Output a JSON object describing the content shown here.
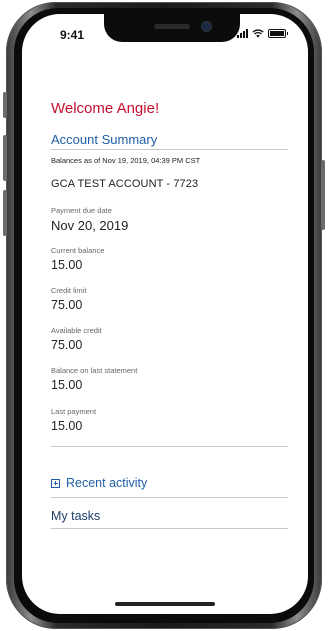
{
  "status_bar": {
    "time": "9:41",
    "icons": [
      "signal-icon",
      "wifi-icon",
      "battery-icon"
    ]
  },
  "welcome": "Welcome Angie!",
  "account_summary": {
    "title": "Account Summary",
    "balances_as_of": "Balances as of Nov 19, 2019, 04:39 PM CST",
    "account_name": "GCA TEST ACCOUNT - 7723",
    "fields": [
      {
        "label": "Payment due date",
        "value": "Nov 20, 2019"
      },
      {
        "label": "Current balance",
        "value": "15.00"
      },
      {
        "label": "Credit limit",
        "value": "75.00"
      },
      {
        "label": "Available credit",
        "value": "75.00"
      },
      {
        "label": "Balance on last statement",
        "value": "15.00"
      },
      {
        "label": "Last payment",
        "value": "15.00"
      }
    ]
  },
  "recent_activity": "Recent activity",
  "my_tasks": "My tasks",
  "colors": {
    "welcome": "#c8102e",
    "accent": "#1f5fa8",
    "rule": "#c9c9c9"
  }
}
